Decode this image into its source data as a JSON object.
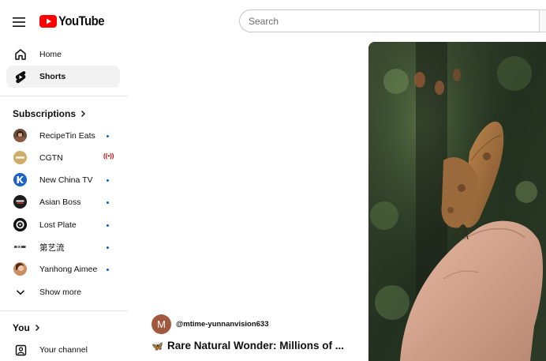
{
  "header": {
    "logo_text": "YouTube",
    "search_placeholder": "Search"
  },
  "sidebar": {
    "main_items": [
      {
        "label": "Home",
        "icon": "home-icon"
      },
      {
        "label": "Shorts",
        "icon": "shorts-icon",
        "active": true
      }
    ],
    "subscriptions_title": "Subscriptions",
    "subscriptions": [
      {
        "label": "RecipeTin Eats",
        "status": "new-content"
      },
      {
        "label": "CGTN",
        "status": "live"
      },
      {
        "label": "New China TV",
        "status": "new-content"
      },
      {
        "label": "Asian Boss",
        "status": "new-content"
      },
      {
        "label": "Lost Plate",
        "status": "new-content"
      },
      {
        "label": "第艺流",
        "status": "new-content"
      },
      {
        "label": "Yanhong Aimee",
        "status": "new-content"
      }
    ],
    "live_indicator": "((•))",
    "show_more_label": "Show more",
    "you_title": "You",
    "you_items": [
      {
        "label": "Your channel",
        "icon": "channel-icon"
      }
    ]
  },
  "short": {
    "channel_avatar_letter": "M",
    "channel_handle": "@mtime-yunnanvision633",
    "title_emoji": "🦋",
    "title": "Rare Natural Wonder: Millions of ..."
  },
  "colors": {
    "brand_red": "#ff0000",
    "link_blue": "#065fd4",
    "active_bg": "#f2f2f2",
    "avatar_brown": "#a1583d"
  }
}
